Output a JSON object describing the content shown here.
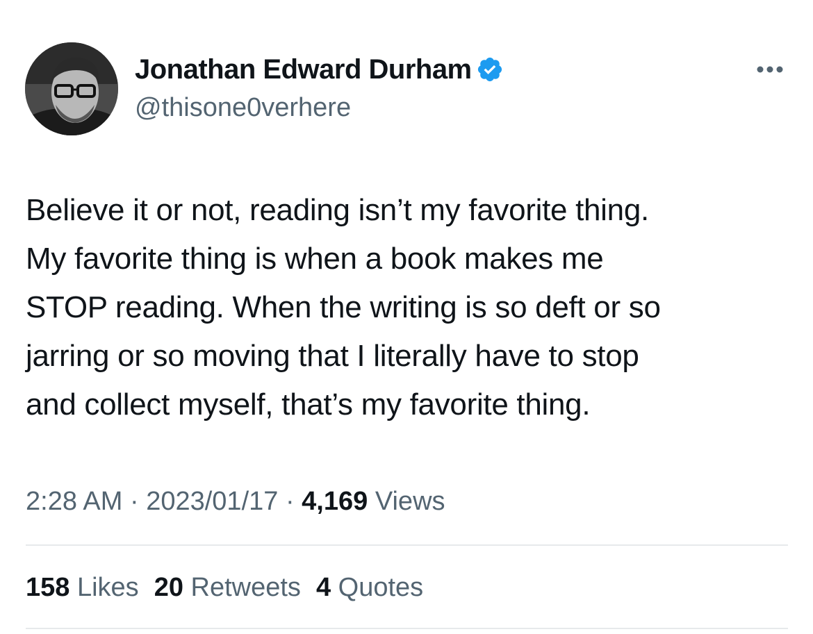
{
  "author": {
    "display_name": "Jonathan Edward Durham",
    "handle": "@thisone0verhere",
    "verified_icon": "verified-badge-icon",
    "verified_color": "#1d9bf0",
    "avatar_icon": "profile-photo"
  },
  "menu": {
    "icon": "more-options-icon"
  },
  "tweet": {
    "text": "Believe it or not, reading isn’t my favorite thing.\nMy favorite thing is when a book makes me\nSTOP reading. When the writing is so deft or so\njarring or so moving that I literally have to stop\nand collect myself, that’s my favorite thing."
  },
  "meta": {
    "time": "2:28 AM",
    "separator": " · ",
    "date": "2023/01/17",
    "views_count": "4,169",
    "views_label": "Views"
  },
  "stats": {
    "likes_count": "158",
    "likes_label": "Likes",
    "retweets_count": "20",
    "retweets_label": "Retweets",
    "quotes_count": "4",
    "quotes_label": "Quotes"
  },
  "colors": {
    "text_primary": "#0f1419",
    "text_secondary": "#536471",
    "divider": "#e6e9eb"
  }
}
